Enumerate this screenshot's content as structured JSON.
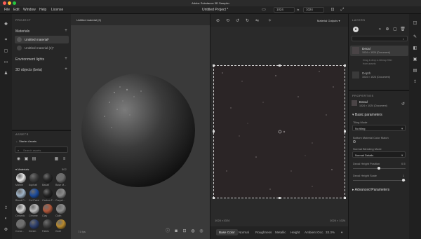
{
  "window": {
    "title": "Adobe Substance 3D Sampler",
    "doc_title": "Untitled Project *"
  },
  "menu": [
    "File",
    "Edit",
    "Window",
    "Help",
    "License"
  ],
  "viewport3d": {
    "tab_label": "Untitled material (2)",
    "fps": "71 fps"
  },
  "toolbar": {
    "resolution": "1024",
    "resolution2": "1024",
    "lock": "⇆"
  },
  "project": {
    "header": "PROJECT",
    "materials_label": "Materials",
    "materials": [
      "Untitled material*",
      "Untitled material (2)*"
    ],
    "env_lights": "Environment lights",
    "objects": "3D objects (beta)"
  },
  "assets": {
    "header": "ASSETS",
    "breadcrumb": "Starter Assets",
    "search_placeholder": "Search assets",
    "category": "Materials",
    "count": "502",
    "swatches": [
      {
        "label": "Marble",
        "color": "#e6e6e6"
      },
      {
        "label": "Asphalt",
        "color": "#3b3b3b"
      },
      {
        "label": "Basalt",
        "color": "#262626"
      },
      {
        "label": "Base M...",
        "color": "#6b6b6b"
      },
      {
        "label": "Blood P...",
        "color": "#9fb4c8"
      },
      {
        "label": "Col Paint",
        "color": "#1b4a9a"
      },
      {
        "label": "Carbon F...",
        "color": "#222222"
      },
      {
        "label": "Carpet...",
        "color": "#8a8a8a"
      },
      {
        "label": "Ceramic",
        "color": "#cfcfcf"
      },
      {
        "label": "Chrome",
        "color": "#bcbcbc"
      },
      {
        "label": "Clay",
        "color": "#b0573a"
      },
      {
        "label": "Cloth",
        "color": "#8c8c8c"
      },
      {
        "label": "Concr...",
        "color": "#6f6f6f"
      },
      {
        "label": "Denim",
        "color": "#2b3d6b"
      },
      {
        "label": "Fabric",
        "color": "#3a3a3a"
      },
      {
        "label": "Gold",
        "color": "#b8892c"
      }
    ]
  },
  "viewport2d": {
    "channel_dropdown": "Material Outputs",
    "status_left": "1024 ×1024",
    "status_right": "1024 × 1024",
    "channels": [
      "Base Color",
      "Normal",
      "Roughness",
      "Metallic",
      "Height",
      "Ambient Occ."
    ],
    "zoom": "33.3%"
  },
  "layers": {
    "header": "LAYERS",
    "search_placeholder": "",
    "items": [
      {
        "name": "Decal",
        "sub": "1024 × 1024 (Document)"
      },
      {
        "name": "Drag & drop a bitmap filter",
        "sub": "from assets"
      },
      {
        "name": "Depth",
        "sub": "1024 × 1024 (Document)"
      }
    ]
  },
  "properties": {
    "header": "PROPERTIES",
    "layer_name": "Decal",
    "layer_sub": "1024 × 1024 (Document)",
    "section_basic": "Basic parameters",
    "tiling_mode_label": "Tiling Mode",
    "tiling_mode_value": "No tiling",
    "bottom_color_label": "Bottom Material Color Match",
    "normal_blend_label": "Normal Blending Mode",
    "normal_blend_value": "Normal Details",
    "decal_height_pos_label": "Decal Height Position",
    "decal_height_pos_value": "0.5",
    "decal_height_scale_label": "Decal Height Scale",
    "decal_height_scale_value": "1",
    "section_advanced": "Advanced Parameters"
  }
}
